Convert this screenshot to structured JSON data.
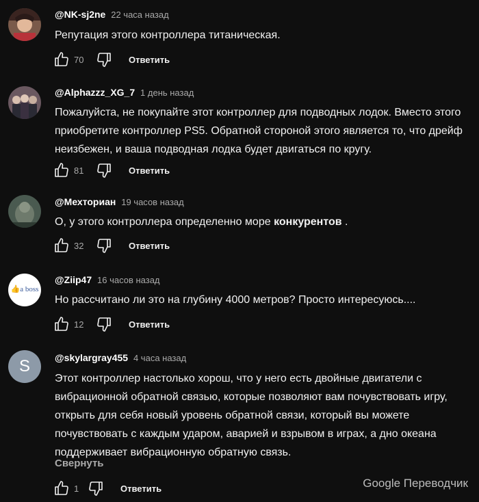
{
  "comments": [
    {
      "author": "@NK-sj2ne",
      "time": "22 часа назад",
      "text": "Репутация этого контроллера титаническая.",
      "likes": "70",
      "reply_label": "Ответить"
    },
    {
      "author": "@Alphazzz_XG_7",
      "time": "1 день назад",
      "text": "Пожалуйста, не покупайте этот контроллер для подводных лодок. Вместо этого приобретите контроллер PS5. Обратной стороной этого является то, что дрейф неизбежен, и ваша подводная лодка будет двигаться по кругу.",
      "likes": "81",
      "reply_label": "Ответить"
    },
    {
      "author": "@Мехториан",
      "time": "19 часов назад",
      "text_before": "О, у этого контроллера определенно море ",
      "text_bold": "конкурентов",
      "text_after": " .",
      "likes": "32",
      "reply_label": "Ответить"
    },
    {
      "author": "@Ziip47",
      "time": "16 часов назад",
      "avatar_text": "a boss",
      "text": "Но рассчитано ли это на глубину 4000 метров? Просто интересуюсь....",
      "likes": "12",
      "reply_label": "Ответить"
    },
    {
      "author": "@skylargray455",
      "time": "4 часа назад",
      "avatar_letter": "S",
      "text": "Этот контроллер настолько хорош, что у него есть двойные двигатели с вибрационной обратной связью, которые позволяют вам почувствовать игру, открыть для себя новый уровень обратной связи, который вы можете почувствовать с каждым ударом, аварией и взрывом в играх, а дно океана поддерживает вибрационную обратную связь.",
      "collapse_label": "Свернуть",
      "likes": "1",
      "reply_label": "Ответить"
    }
  ],
  "translator_label": "Google Переводчик",
  "colors": {
    "background": "#0f0f0f",
    "text": "#f1f1f1",
    "secondary": "#aaaaaa",
    "avatar_s": "#8d9aa8"
  },
  "icons": {
    "like": "thumbs-up-icon",
    "dislike": "thumbs-down-icon"
  }
}
